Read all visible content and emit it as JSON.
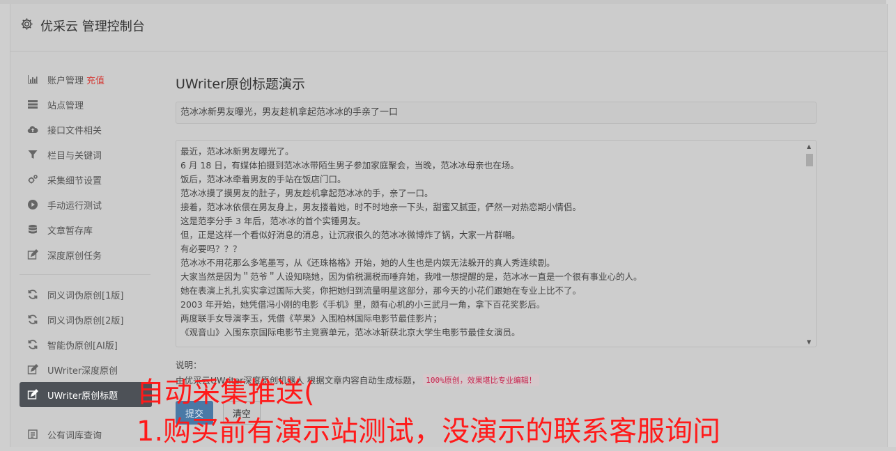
{
  "app": {
    "title": "优采云 管理控制台"
  },
  "sidebar": {
    "group1": [
      {
        "label": "账户管理",
        "badge": "充值"
      },
      {
        "label": "站点管理"
      },
      {
        "label": "接口文件相关"
      },
      {
        "label": "栏目与关键词"
      },
      {
        "label": "采集细节设置"
      },
      {
        "label": "手动运行测试"
      },
      {
        "label": "文章暂存库"
      },
      {
        "label": "深度原创任务"
      }
    ],
    "group2": [
      {
        "label": "同义词伪原创[1版]"
      },
      {
        "label": "同义词伪原创[2版]"
      },
      {
        "label": "智能伪原创[AI版]"
      },
      {
        "label": "UWriter深度原创"
      },
      {
        "label": "UWriter原创标题"
      }
    ],
    "group3": [
      {
        "label": "公有词库查询"
      }
    ]
  },
  "main": {
    "title": "UWriter原创标题演示",
    "title_value": "范冰冰新男友曝光，男友趁机拿起范冰冰的手亲了一口",
    "content_lines": [
      "最近，范冰冰新男友曝光了。",
      "6 月 18 日，有媒体拍摄到范冰冰带陌生男子参加家庭聚会，当晚，范冰冰母亲也在场。",
      "饭后，范冰冰牵着男友的手站在饭店门口。",
      "范冰冰摸了摸男友的肚子，男友趁机拿起范冰冰的手，亲了一口。",
      "接着，范冰冰依偎在男友身上，男友搂着她，时不时地亲一下头，甜蜜又腻歪，俨然一对热恋期小情侣。",
      "这是范李分手 3 年后，范冰冰的首个实锤男友。",
      "但，正是这样一个看似好消息的消息，让沉寂很久的范冰冰微博炸了锅，大家一片群嘲。",
      "有必要吗？？？",
      "范冰冰不用花那么多笔墨写，从《还珠格格》开始，她的人生也是内娱无法躲开的真人秀连续剧。",
      "大家当然是因为＂范爷＂人设知晓她，因为偷税漏税而唾弃她，我唯一想提醒的是，范冰冰一直是一个很有事业心的人。",
      "她在表演上扎扎实实拿过国际大奖，你把她归到流量明星这部分，那今天的小花们跟她在专业上比不了。",
      "2003 年开始，她凭借冯小刚的电影《手机》里，颇有心机的小三武月一角，拿下百花奖影后。",
      "两度联手女导演李玉，凭借《苹果》入围柏林国际电影节最佳影片；",
      "《观音山》入围东京国际电影节主竞赛单元，范冰冰斩获北京大学生电影节最佳女演员。"
    ],
    "note_label": "说明：",
    "note_text": "由优采云UWriter深度原创机器人 根据文章内容自动生成标题，",
    "note_code": "100%原创，效果堪比专业编辑！",
    "submit_label": "提交",
    "clear_label": "清空"
  },
  "overlay": {
    "line1": "自动采集推送(",
    "line2": "1.购买前有演示站测试，没演示的联系客服询问"
  }
}
